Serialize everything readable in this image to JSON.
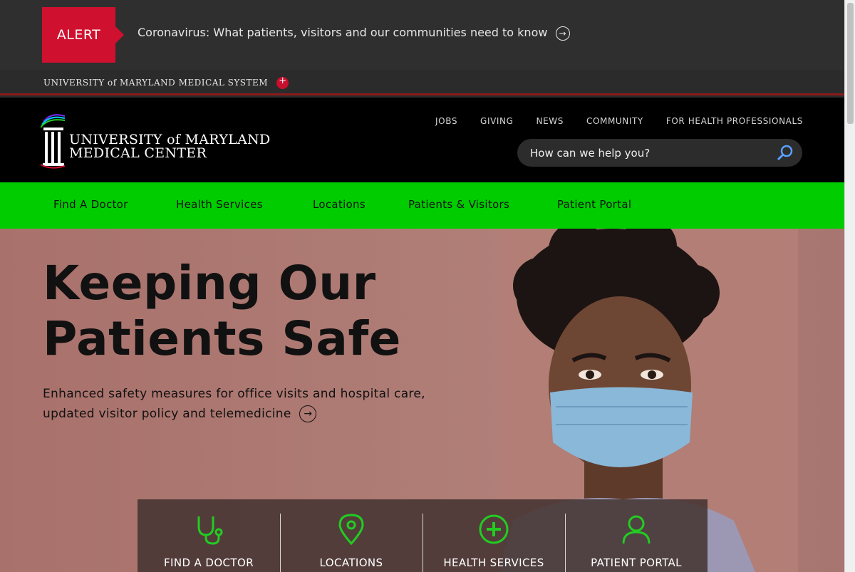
{
  "alert": {
    "badge": "ALERT",
    "message": "Coronavirus: What patients, visitors and our communities need to know",
    "arrow": "→"
  },
  "system_bar": {
    "name": "UNIVERSITY of MARYLAND MEDICAL SYSTEM"
  },
  "header": {
    "logo_line1": "UNIVERSITY of MARYLAND",
    "logo_line2": "MEDICAL CENTER",
    "utility_nav": [
      "JOBS",
      "GIVING",
      "NEWS",
      "COMMUNITY",
      "FOR HEALTH PROFESSIONALS"
    ],
    "search_placeholder": "How can we help you?"
  },
  "main_nav": [
    "Find A Doctor",
    "Health Services",
    "Locations",
    "Patients & Visitors",
    "Patient Portal"
  ],
  "hero": {
    "title_line1": "Keeping Our",
    "title_line2": "Patients Safe",
    "subtitle": "Enhanced safety measures for office visits and hospital care, updated visitor policy and telemedicine",
    "arrow": "→"
  },
  "quick_links": [
    {
      "label": "FIND A DOCTOR",
      "icon": "stethoscope-icon"
    },
    {
      "label": "LOCATIONS",
      "icon": "map-pin-icon"
    },
    {
      "label": "HEALTH SERVICES",
      "icon": "plus-circle-icon"
    },
    {
      "label": "PATIENT PORTAL",
      "icon": "user-icon"
    }
  ],
  "colors": {
    "alert_red": "#d0102f",
    "nav_green": "#00cc00",
    "icon_green": "#22cc22"
  }
}
